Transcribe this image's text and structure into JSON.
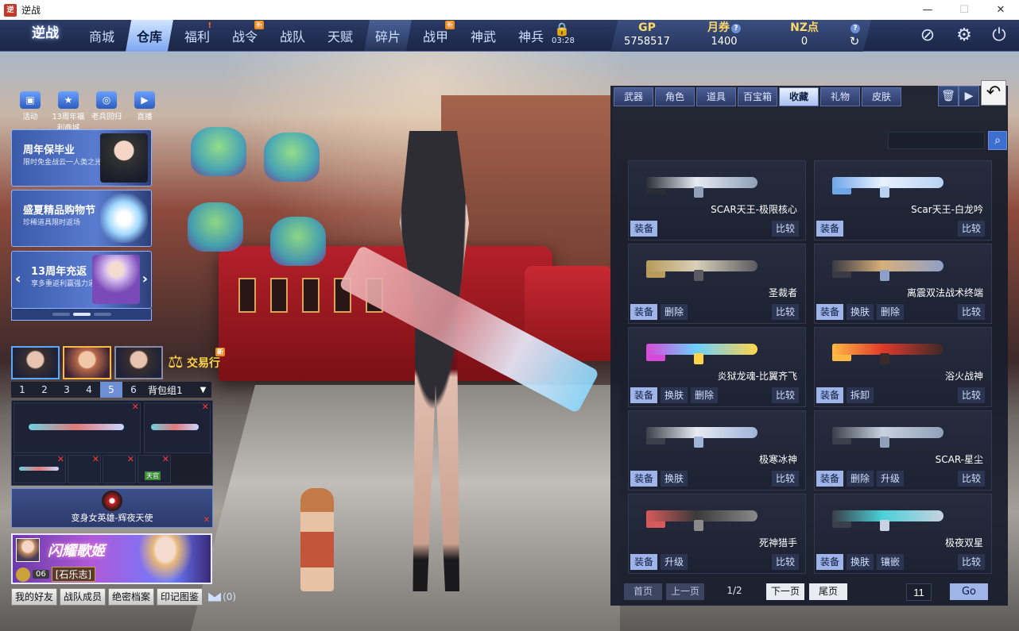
{
  "window": {
    "title": "逆战",
    "app_icon_glyph": "逆",
    "minimize": "—",
    "maximize": "☐",
    "close": "✕"
  },
  "logo": "逆战",
  "nav": {
    "tabs": [
      {
        "label": "商城",
        "state": "normal",
        "badge": ""
      },
      {
        "label": "仓库",
        "state": "active",
        "badge": ""
      },
      {
        "label": "福利",
        "state": "normal",
        "badge": "!"
      },
      {
        "label": "战令",
        "state": "normal",
        "badge": "新"
      },
      {
        "label": "战队",
        "state": "normal",
        "badge": ""
      },
      {
        "label": "天赋",
        "state": "normal",
        "badge": ""
      },
      {
        "label": "碎片",
        "state": "tinted",
        "badge": ""
      },
      {
        "label": "战甲",
        "state": "normal",
        "badge": "新"
      },
      {
        "label": "神武",
        "state": "normal",
        "badge": ""
      },
      {
        "label": "神兵",
        "state": "normal",
        "badge": ""
      }
    ],
    "lock_time": "03:28"
  },
  "currency": {
    "gp_label": "GP",
    "gp_value": "5758517",
    "voucher_label": "月券",
    "voucher_value": "1400",
    "nz_label": "NZ点",
    "nz_value": "0",
    "help_glyph": "?",
    "refresh_glyph": "↻"
  },
  "top_icons": {
    "settings": "⚙",
    "power": "⏻",
    "link": "⊘"
  },
  "quick_links": [
    {
      "label": "活动",
      "glyph": "▣"
    },
    {
      "label": "13周年福利商城",
      "glyph": "★"
    },
    {
      "label": "老兵回归",
      "glyph": "◎"
    },
    {
      "label": "直播",
      "glyph": "▶"
    }
  ],
  "promos": [
    {
      "title": "周年保毕业",
      "subtitle": "限时免金战云一人类之光"
    },
    {
      "title": "盛夏精品购物节",
      "subtitle": "珍稀道具限时返场"
    },
    {
      "title": "13周年充返",
      "subtitle": "享多重返利赢强力道具",
      "prev": "‹",
      "next": "›"
    }
  ],
  "exchange": {
    "label": "交易行",
    "badge": "新"
  },
  "bag": {
    "tabs": [
      "1",
      "2",
      "3",
      "4",
      "5",
      "6"
    ],
    "active_index": 4,
    "group_label": "背包组1",
    "caret": "▼",
    "slot_remove_glyph": "✕",
    "tag_label": "天官"
  },
  "hero_skin": {
    "label": "变身女英雄-辉夜天使",
    "remove_glyph": "✕"
  },
  "banner": {
    "title": "闪耀歌姬",
    "level": "06",
    "player_name": "[石乐志]"
  },
  "bottom_buttons": [
    "我的好友",
    "战队成员",
    "绝密档案",
    "印记图鉴"
  ],
  "mail_count": "(0)",
  "inventory": {
    "tabs": [
      "武器",
      "角色",
      "道具",
      "百宝箱",
      "收藏",
      "礼物",
      "皮肤"
    ],
    "active_tab": "收藏",
    "trash_glyph": "🗑",
    "video_glyph": "▶",
    "back_glyph": "↶",
    "search_value": "",
    "search_glyph": "⌕",
    "compare_label": "比较",
    "items": [
      {
        "name": "SCAR天王-极限核心",
        "actions": [
          "装备"
        ],
        "colors": [
          "#e6ebf2",
          "#2a2d36",
          "#8fa0b8"
        ]
      },
      {
        "name": "Scar天王-白龙吟",
        "actions": [
          "装备"
        ],
        "colors": [
          "#e8f1ff",
          "#6fa6e8",
          "#b9d2f2"
        ]
      },
      {
        "name": "圣裁者",
        "actions": [
          "装备",
          "删除"
        ],
        "colors": [
          "#d8d0b8",
          "#b89a5a",
          "#5a5a60"
        ]
      },
      {
        "name": "离震双法战术终端",
        "actions": [
          "装备",
          "换肤",
          "删除"
        ],
        "colors": [
          "#d8b07a",
          "#3a3a44",
          "#8fa0c8"
        ]
      },
      {
        "name": "炎狱龙魂-比翼齐飞",
        "actions": [
          "装备",
          "换肤",
          "删除"
        ],
        "colors": [
          "#6ad0ff",
          "#d84ad8",
          "#ffd44a"
        ]
      },
      {
        "name": "浴火战神",
        "actions": [
          "装备",
          "拆卸"
        ],
        "colors": [
          "#e03a2a",
          "#ffb844",
          "#3a2a2a"
        ]
      },
      {
        "name": "极寒冰神",
        "actions": [
          "装备",
          "换肤"
        ],
        "colors": [
          "#e6ebf2",
          "#3a3f4a",
          "#9fb4d8"
        ]
      },
      {
        "name": "SCAR-星尘",
        "actions": [
          "装备",
          "删除",
          "升级"
        ],
        "colors": [
          "#c8d2e0",
          "#3a3f4a",
          "#8fa0b8"
        ]
      },
      {
        "name": "死神猎手",
        "actions": [
          "装备",
          "升级"
        ],
        "colors": [
          "#3a3a3a",
          "#d85a5a",
          "#8a8a8a"
        ]
      },
      {
        "name": "极夜双星",
        "actions": [
          "装备",
          "换肤",
          "镶嵌"
        ],
        "colors": [
          "#4ad0d8",
          "#3a3f4a",
          "#c8d2e0"
        ]
      }
    ]
  },
  "pager": {
    "first": "首页",
    "prev": "上一页",
    "page_info": "1/2",
    "next": "下一页",
    "last": "尾页",
    "jump_value": "11",
    "go": "Go"
  }
}
